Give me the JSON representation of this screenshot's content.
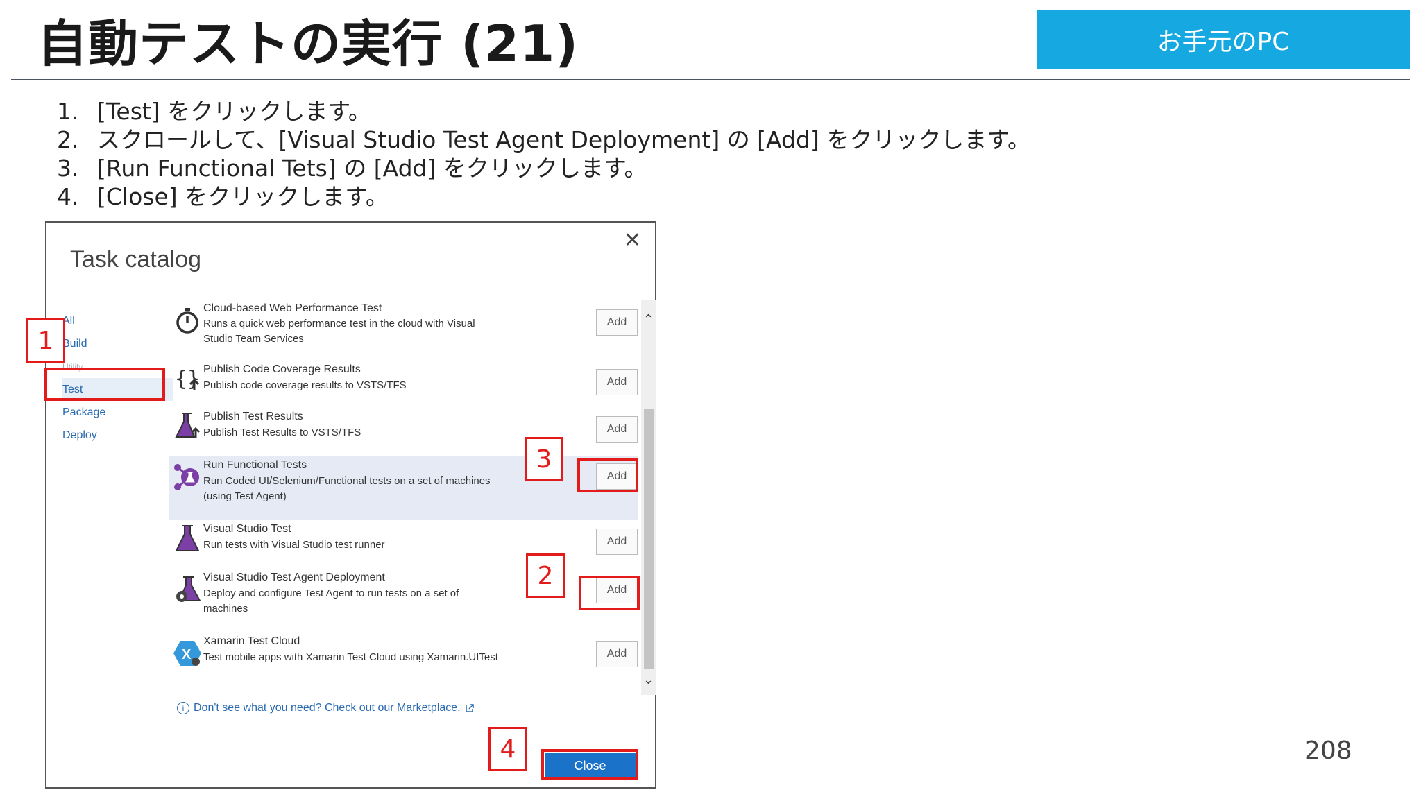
{
  "slide": {
    "title": "自動テストの実行 (21)",
    "badge": "お手元のPC",
    "page_number": "208",
    "steps": [
      {
        "num": "1.",
        "text": "[Test] をクリックします。"
      },
      {
        "num": "2.",
        "text": "スクロールして、[Visual Studio Test Agent Deployment] の [Add] をクリックします。"
      },
      {
        "num": "3.",
        "text": "[Run Functional Tets] の [Add] をクリックします。"
      },
      {
        "num": "4.",
        "text": "[Close] をクリックします。"
      }
    ]
  },
  "dialog": {
    "title": "Task catalog",
    "close_glyph": "✕",
    "categories": [
      "All",
      "Build",
      "Utility",
      "Test",
      "Package",
      "Deploy"
    ],
    "active_category": "Test",
    "tasks": [
      {
        "title": "Cloud-based Web Performance Test",
        "desc": "Runs a quick web performance test in the cloud with Visual Studio Team Services",
        "icon": "stopwatch-icon",
        "add": "Add"
      },
      {
        "title": "Publish Code Coverage Results",
        "desc": "Publish code coverage results to VSTS/TFS",
        "icon": "code-coverage-icon",
        "add": "Add"
      },
      {
        "title": "Publish Test Results",
        "desc": "Publish Test Results to VSTS/TFS",
        "icon": "flask-upload-icon",
        "add": "Add"
      },
      {
        "title": "Run Functional Tests",
        "desc": "Run Coded UI/Selenium/Functional tests on a set of machines (using Test Agent)",
        "icon": "functional-test-icon",
        "add": "Add"
      },
      {
        "title": "Visual Studio Test",
        "desc": "Run tests with Visual Studio test runner",
        "icon": "flask-icon",
        "add": "Add"
      },
      {
        "title": "Visual Studio Test Agent Deployment",
        "desc": "Deploy and configure Test Agent to run tests on a set of machines",
        "icon": "flask-gear-icon",
        "add": "Add"
      },
      {
        "title": "Xamarin Test Cloud",
        "desc": "Test mobile apps with Xamarin Test Cloud using Xamarin.UITest",
        "icon": "xamarin-icon",
        "add": "Add"
      }
    ],
    "marketplace_text": "Don't see what you need? Check out our Marketplace.",
    "close_label": "Close",
    "scroll_up": "⌃",
    "scroll_down": "⌄"
  },
  "annotations": [
    "1",
    "2",
    "3",
    "4"
  ],
  "colors": {
    "badge": "#16a8e0",
    "annotation": "#e41b1b",
    "close_button": "#1a73c8",
    "link": "#2a6ab0"
  }
}
